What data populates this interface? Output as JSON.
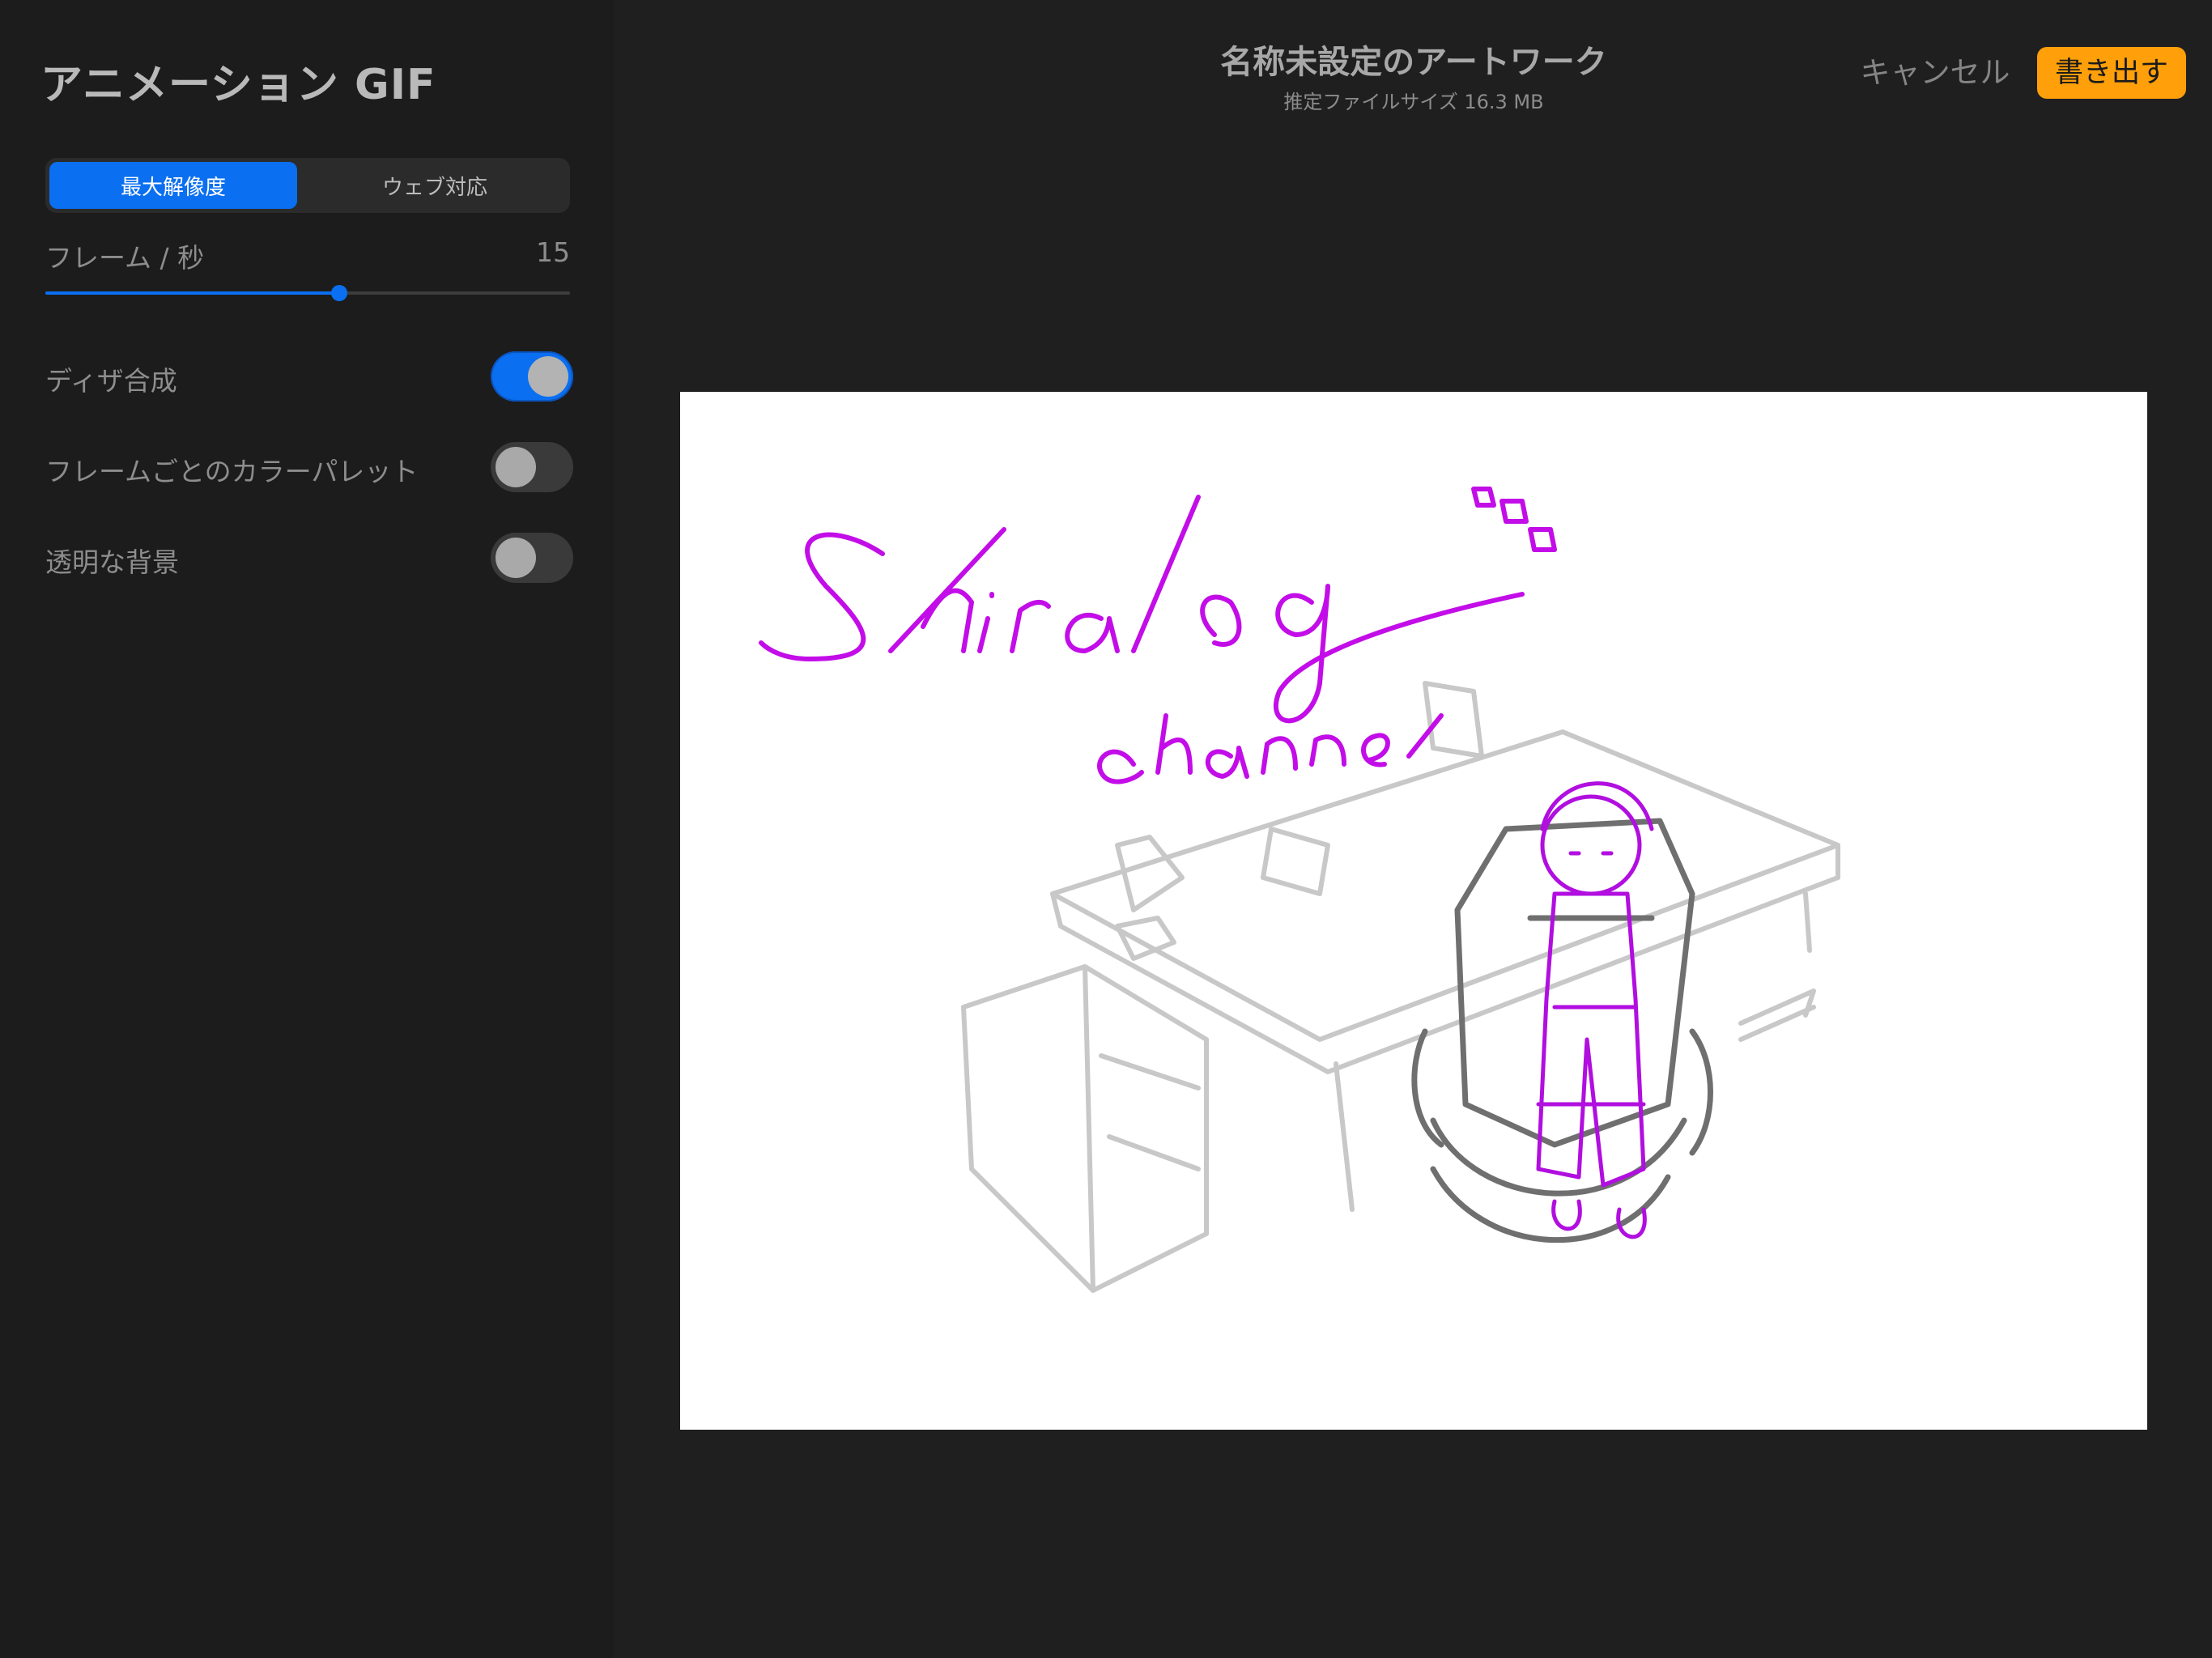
{
  "panel": {
    "title": "アニメーション GIF",
    "segments": [
      {
        "label": "最大解像度",
        "selected": true
      },
      {
        "label": "ウェブ対応",
        "selected": false
      }
    ],
    "slider": {
      "label": "フレーム / 秒",
      "value_text": "15",
      "fill_fraction": 0.56
    },
    "toggles": [
      {
        "label": "ディザ合成",
        "on": true
      },
      {
        "label": "フレームごとのカラーパレット",
        "on": false
      },
      {
        "label": "透明な背景",
        "on": false
      }
    ]
  },
  "header": {
    "title": "名称未設定のアートワーク",
    "subtitle": "推定ファイルサイズ 16.3 MB",
    "cancel_label": "キャンセル",
    "export_label": "書き出す"
  },
  "colors": {
    "accent": "#0a6ff0",
    "export": "#ff9f0a",
    "sketch_magenta": "#b10ee0",
    "sketch_gray": "#8a8a8a"
  }
}
